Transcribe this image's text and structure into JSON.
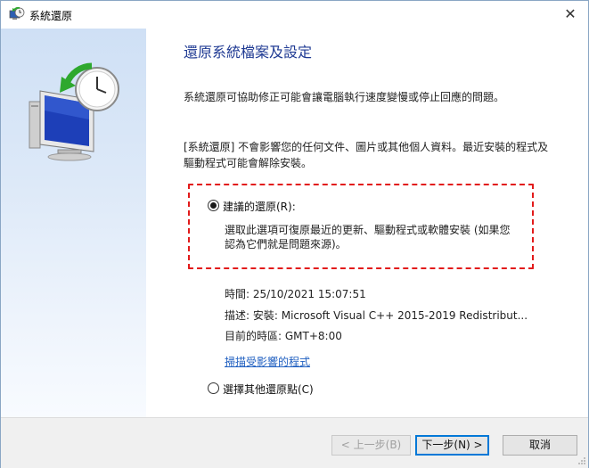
{
  "window": {
    "title": "系統還原",
    "close_glyph": "✕"
  },
  "main": {
    "heading": "還原系統檔案及設定",
    "intro": "系統還原可協助修正可能會讓電腦執行速度變慢或停止回應的問題。",
    "notice": "[系統還原] 不會影響您的任何文件、圖片或其他個人資料。最近安裝的程式及驅動程式可能會解除安裝。"
  },
  "options": {
    "recommended": {
      "label": "建議的還原(R):",
      "description": "選取此選項可復原最近的更新、驅動程式或軟體安裝 (如果您認為它們就是問題來源)。",
      "selected": true
    },
    "other": {
      "label": "選擇其他還原點(C)",
      "selected": false
    }
  },
  "restore_point": {
    "time": "時間: 25/10/2021 15:07:51",
    "description": "描述: 安裝: Microsoft Visual C++ 2015-2019 Redistribut...",
    "timezone": "目前的時區: GMT+8:00",
    "scan_link": "掃描受影響的程式"
  },
  "buttons": {
    "back": "< 上一步(B)",
    "next": "下一步(N) >",
    "cancel": "取消"
  },
  "colors": {
    "heading": "#1f3a93",
    "link": "#1f5fc0",
    "highlight_border": "#e21b1b",
    "default_button_border": "#0078d7"
  },
  "icons": [
    "system-restore-icon",
    "close-icon",
    "computer-restore-illustration",
    "resize-grip-icon"
  ]
}
